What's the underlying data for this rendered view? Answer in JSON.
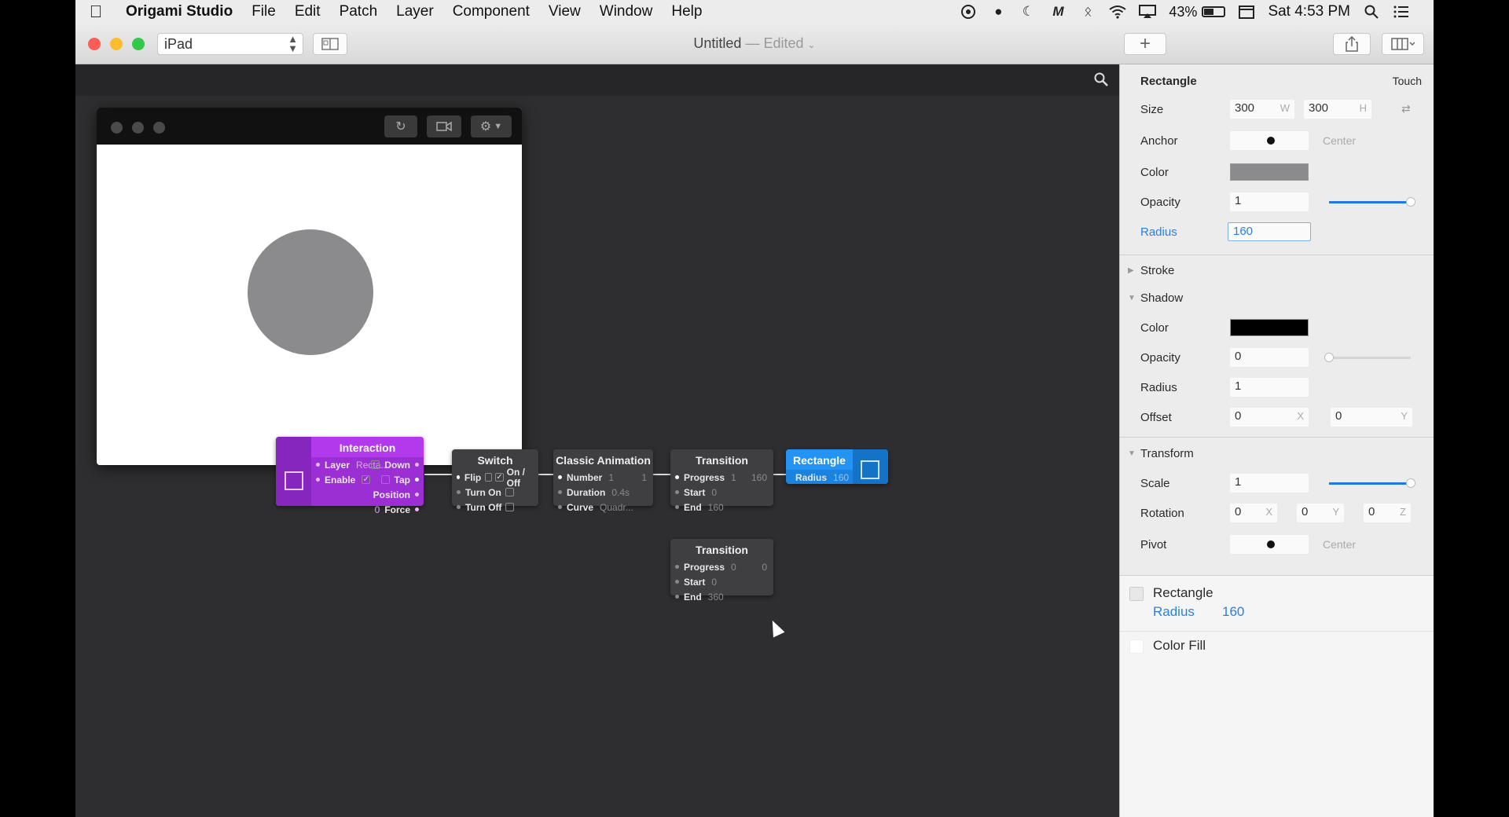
{
  "menubar": {
    "app_name": "Origami Studio",
    "menus": [
      "File",
      "Edit",
      "Patch",
      "Layer",
      "Component",
      "View",
      "Window",
      "Help"
    ],
    "battery": "43%",
    "clock": "Sat 4:53 PM"
  },
  "toolbar": {
    "device": "iPad",
    "doc_title": "Untitled",
    "doc_status": "— Edited",
    "add_label": "+"
  },
  "patches": {
    "interaction": {
      "title": "Interaction",
      "layer_label": "Layer",
      "layer_value": "Recta...",
      "enable_label": "Enable",
      "down_label": "Down",
      "tap_label": "Tap",
      "position_label": "Position",
      "force_label": "Force",
      "force_value": "0"
    },
    "switch": {
      "title": "Switch",
      "flip_label": "Flip",
      "onoff_label": "On / Off",
      "turn_on_label": "Turn On",
      "turn_off_label": "Turn Off"
    },
    "classic_animation": {
      "title": "Classic Animation",
      "number_label": "Number",
      "number_value": "1",
      "output_value": "1",
      "duration_label": "Duration",
      "duration_value": "0.4s",
      "curve_label": "Curve",
      "curve_value": "Quadr..."
    },
    "transition1": {
      "title": "Transition",
      "progress_label": "Progress",
      "progress_value": "1",
      "output_value": "160",
      "start_label": "Start",
      "start_value": "0",
      "end_label": "End",
      "end_value": "160"
    },
    "rectangle": {
      "title": "Rectangle",
      "radius_label": "Radius",
      "radius_value": "160"
    },
    "transition2": {
      "title": "Transition",
      "progress_label": "Progress",
      "progress_value": "0",
      "output_value": "0",
      "start_label": "Start",
      "start_value": "0",
      "end_label": "End",
      "end_value": "360"
    }
  },
  "inspector": {
    "title": "Rectangle",
    "touch_label": "Touch",
    "size_label": "Size",
    "width_value": "300",
    "width_suffix": "W",
    "height_value": "300",
    "height_suffix": "H",
    "anchor_label": "Anchor",
    "anchor_hint": "Center",
    "color_label": "Color",
    "color_value": "#8b8b8d",
    "opacity_label": "Opacity",
    "opacity_value": "1",
    "opacity_level": 1.0,
    "radius_label": "Radius",
    "radius_value": "160",
    "stroke_label": "Stroke",
    "shadow": {
      "label": "Shadow",
      "color_label": "Color",
      "color_value": "#000000",
      "opacity_label": "Opacity",
      "opacity_value": "0",
      "opacity_level": 0.0,
      "radius_label": "Radius",
      "radius_value": "1",
      "offset_label": "Offset",
      "offset_x": "0",
      "offset_x_suffix": "X",
      "offset_y": "0",
      "offset_y_suffix": "Y"
    },
    "transform": {
      "label": "Transform",
      "scale_label": "Scale",
      "scale_value": "1",
      "scale_level": 1.0,
      "rotation_label": "Rotation",
      "rot_x": "0",
      "rot_x_suffix": "X",
      "rot_y": "0",
      "rot_y_suffix": "Y",
      "rot_z": "0",
      "rot_z_suffix": "Z",
      "pivot_label": "Pivot",
      "pivot_hint": "Center"
    },
    "layers": {
      "rect_name": "Rectangle",
      "rect_prop_label": "Radius",
      "rect_prop_value": "160",
      "colorfill_name": "Color Fill"
    }
  },
  "colors": {
    "accent": "#1e78e6",
    "interaction_patch": "#9b2fd3",
    "layer_patch": "#1a83e0",
    "canvas": "#2e2e30"
  }
}
